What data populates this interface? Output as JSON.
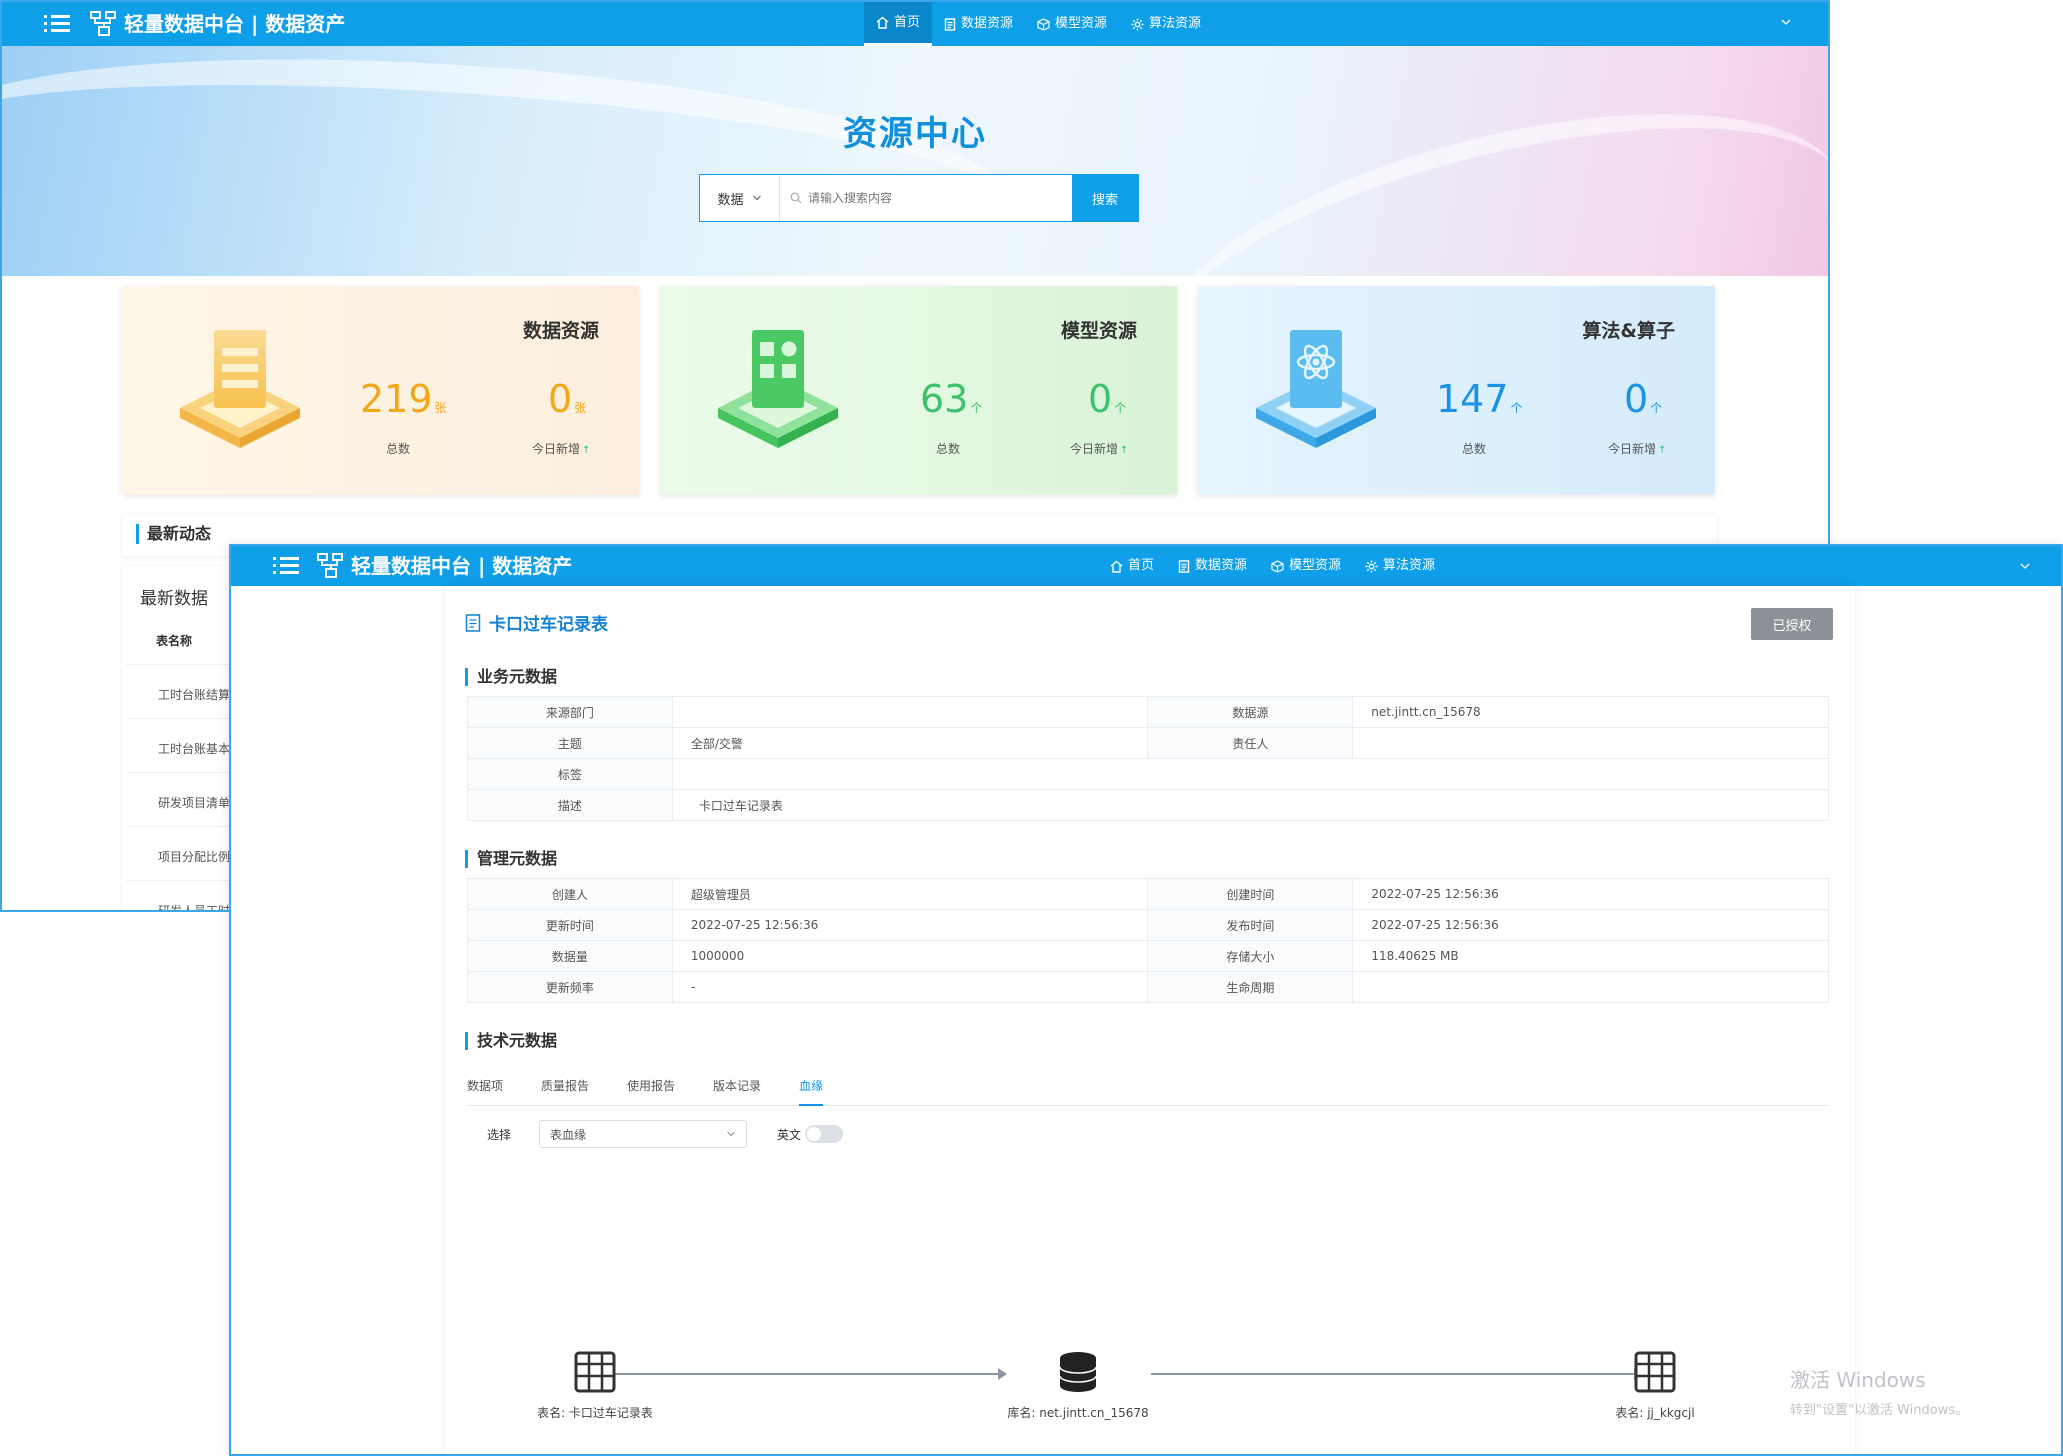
{
  "app": {
    "title": "轻量数据中台 | 数据资产",
    "nav": [
      {
        "label": "首页",
        "icon": "home-icon"
      },
      {
        "label": "数据资源",
        "icon": "document-icon"
      },
      {
        "label": "模型资源",
        "icon": "cube-icon"
      },
      {
        "label": "算法资源",
        "icon": "gear-icon"
      }
    ]
  },
  "home": {
    "hero_title": "资源中心",
    "search": {
      "select_value": "数据",
      "placeholder": "请输入搜索内容",
      "button": "搜索"
    },
    "cards": [
      {
        "title": "数据资源",
        "total": "219",
        "total_unit": "张",
        "today": "0",
        "today_unit": "张",
        "total_label": "总数",
        "today_label": "今日新增",
        "color": "#f4a619"
      },
      {
        "title": "模型资源",
        "total": "63",
        "total_unit": "个",
        "today": "0",
        "today_unit": "个",
        "total_label": "总数",
        "today_label": "今日新增",
        "color": "#3cc26a"
      },
      {
        "title": "算法&算子",
        "total": "147",
        "total_unit": "个",
        "today": "0",
        "today_unit": "个",
        "total_label": "总数",
        "today_label": "今日新增",
        "color": "#1b92e3"
      }
    ],
    "latest_section": "最新动态",
    "latest": {
      "title": "最新数据",
      "column": "表名称",
      "rows": [
        "工时台账结算",
        "工时台账基本",
        "研发项目清单",
        "项目分配比例",
        "研发人员工时"
      ]
    }
  },
  "detail": {
    "title": "卡口过车记录表",
    "auth_button": "已授权",
    "business_meta": {
      "title": "业务元数据",
      "rows": [
        [
          "来源部门",
          "",
          "数据源",
          "net.jintt.cn_15678"
        ],
        [
          "主题",
          "全部/交警",
          "责任人",
          ""
        ],
        [
          "标签",
          "",
          "",
          ""
        ],
        [
          "描述",
          "卡口过车记录表",
          "",
          ""
        ]
      ]
    },
    "management_meta": {
      "title": "管理元数据",
      "rows": [
        [
          "创建人",
          "超级管理员",
          "创建时间",
          "2022-07-25 12:56:36"
        ],
        [
          "更新时间",
          "2022-07-25 12:56:36",
          "发布时间",
          "2022-07-25 12:56:36"
        ],
        [
          "数据量",
          "1000000",
          "存储大小",
          "118.40625 MB"
        ],
        [
          "更新频率",
          "-",
          "生命周期",
          ""
        ]
      ]
    },
    "tech_meta": {
      "title": "技术元数据",
      "tabs": [
        "数据项",
        "质量报告",
        "使用报告",
        "版本记录",
        "血缘"
      ],
      "active_tab": "血缘",
      "filter_label": "选择",
      "filter_value": "表血缘",
      "english_label": "英文"
    },
    "lineage": [
      {
        "caption": "表名:  卡口过车记录表",
        "icon": "table-icon"
      },
      {
        "caption": "库名:  net.jintt.cn_15678",
        "icon": "database-icon"
      },
      {
        "caption": "表名:  jj_kkgcjl",
        "icon": "table-icon"
      }
    ]
  },
  "watermark": {
    "line1": "激活 Windows",
    "line2": "转到\"设置\"以激活 Windows。"
  }
}
